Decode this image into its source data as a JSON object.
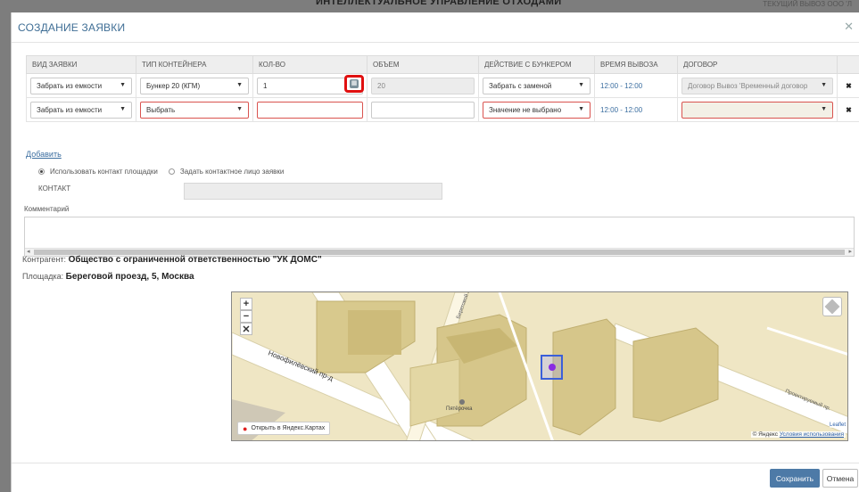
{
  "background": {
    "title": "ИНТЕЛЛЕКТУАЛЬНОЕ УПРАВЛЕНИЕ ОТХОДАМИ",
    "right_text": "ТЕКУЩИЙ ВЫВОЗ ООО 'Л"
  },
  "modal": {
    "title": "СОЗДАНИЕ ЗАЯВКИ",
    "close_icon": "close-icon"
  },
  "table": {
    "headers": [
      "ВИД ЗАЯВКИ",
      "ТИП КОНТЕЙНЕРА",
      "КОЛ-ВО",
      "ОБЪЕМ",
      "ДЕЙСТВИЕ С БУНКЕРОМ",
      "ВРЕМЯ ВЫВОЗА",
      "ДОГОВОР"
    ],
    "rows": [
      {
        "request_type": "Забрать из емкости",
        "container_type": "Бункер 20 (КГМ)",
        "quantity": "1",
        "volume": "20",
        "bunker_action": "Забрать с заменой",
        "pickup_time": "12:00 - 12:00",
        "contract": "Договор Вывоз 'Временный договор"
      },
      {
        "request_type": "Забрать из емкости",
        "container_type": "Выбрать",
        "quantity": "",
        "volume": "",
        "bunker_action": "Значение не выбрано",
        "pickup_time": "12:00 - 12:00",
        "contract": ""
      }
    ],
    "delete_glyph": "✖"
  },
  "add_link": "Добавить",
  "contact": {
    "option_site": "Использовать контакт площадки",
    "option_custom": "Задать контактное лицо заявки",
    "label": "КОНТАКТ"
  },
  "comment_label": "Комментарий",
  "counterparty": {
    "label": "Контрагент:",
    "value": "Общество с ограниченной ответственностью \"УК ДОМС\""
  },
  "site": {
    "label": "Площадка:",
    "value": "Береговой проезд, 5, Москва"
  },
  "map": {
    "street_1": "Новофилёвский пр-д",
    "street_2": "Береговой пр.",
    "street_3": "Проектируемый пр.",
    "poi": "Пятёрочка",
    "open_in_yandex": "Открыть в Яндекс.Картах",
    "copyright_prefix": "© Яндекс",
    "copyright_link": "Условия использования",
    "leaflet": "Leaflet"
  },
  "buttons": {
    "save": "Сохранить",
    "cancel": "Отмена"
  },
  "colors": {
    "accent": "#4d7aa7",
    "error_border": "#d9534f",
    "highlight": "#e01010"
  }
}
